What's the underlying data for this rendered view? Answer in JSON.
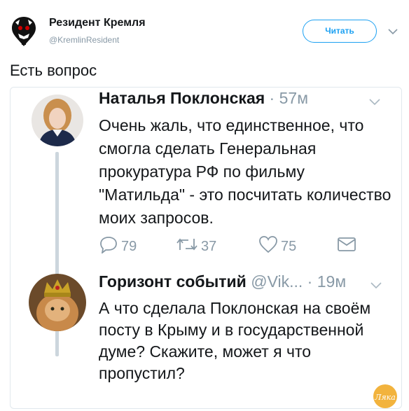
{
  "account": {
    "name": "Резидент Кремля",
    "handle": "@KremlinResident",
    "follow_label": "Читать"
  },
  "tweet": {
    "text": "Есть вопрос"
  },
  "quoted_tweets": [
    {
      "author": "Наталья Поклонская",
      "separator": "·",
      "time": "57м",
      "text": "Очень жаль, что единственное, что смогла сделать Генеральная прокуратура РФ по фильму \"Матильда\" - это посчитать количество моих запросов.",
      "reply_count": "79",
      "retweet_count": "37",
      "like_count": "75"
    },
    {
      "author": "Горизонт событий",
      "handle": "@Vik...",
      "separator": "·",
      "time": "19м",
      "text": "А что сделала Поклонская на своём посту в Крыму и в государственной думе? Скажите, может я что пропустил?"
    }
  ],
  "colors": {
    "accent": "#1da1f2",
    "muted": "#8899a6",
    "text": "#14171a",
    "border": "#e1e8ed"
  },
  "icons": [
    "caret-down-icon",
    "reply-icon",
    "retweet-icon",
    "like-icon",
    "dm-icon"
  ],
  "watermark": "Ляка"
}
